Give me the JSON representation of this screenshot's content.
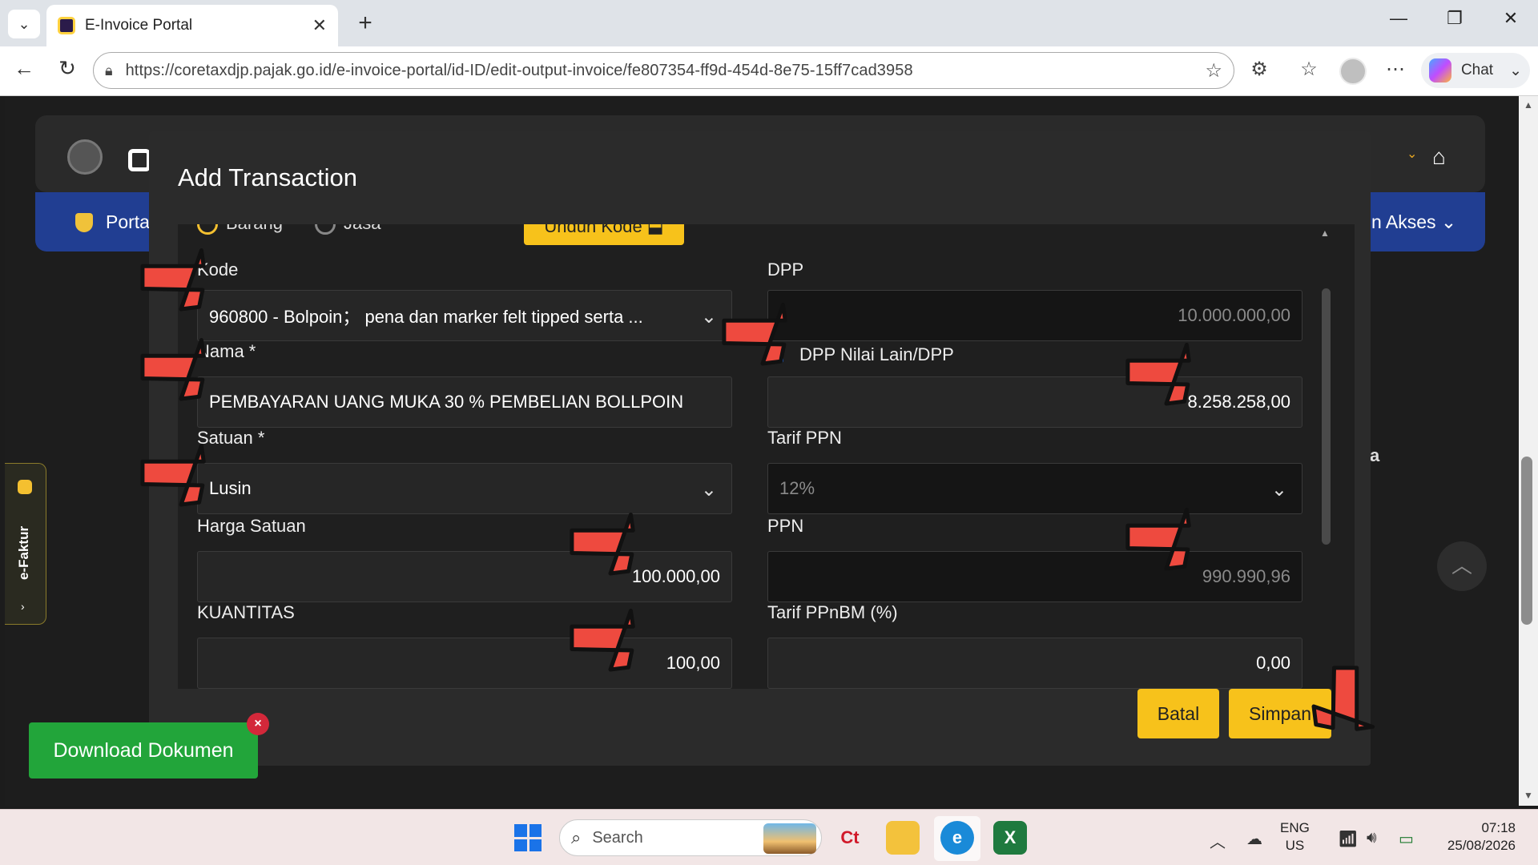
{
  "browser": {
    "tab_title": "E-Invoice Portal",
    "tab_close": "✕",
    "new_tab": "+",
    "url": "https://coretaxdjp.pajak.go.id/e-invoice-portal/id-ID/edit-output-invoice/fe807354-ff9d-454d-8e75-15ff7cad3958",
    "chat_label": "Chat",
    "window_controls": [
      "—",
      "❐",
      "✕"
    ]
  },
  "app": {
    "portal_label": "Portal",
    "akses_label": "n Akses ⌄",
    "side_label": "e-Faktur",
    "bg_letter": "a"
  },
  "modal": {
    "title": "Add Transaction",
    "radio_options": [
      "Barang",
      "Jasa"
    ],
    "unduh_label": "Unduh Kode ⬓",
    "kode_label": "Kode",
    "kode_value": "960800 - Bolpoin；  pena dan marker felt tipped serta ...",
    "nama_label": "Nama *",
    "nama_value": "PEMBAYARAN UANG MUKA 30 % PEMBELIAN BOLLPOIN",
    "satuan_label": "Satuan *",
    "satuan_value": "Lusin",
    "harga_label": "Harga Satuan",
    "harga_value": "100.000,00",
    "kuantitas_label": "KUANTITAS",
    "kuantitas_value": "100,00",
    "dpp_label": "DPP",
    "dpp_value": "10.000.000,00",
    "dpp_lain_label": "DPP Nilai Lain/DPP",
    "dpp_lain_checked": true,
    "dpp_lain_value": "8.258.258,00",
    "tarif_ppn_label": "Tarif PPN",
    "tarif_ppn_value": "12%",
    "ppn_label": "PPN",
    "ppn_value": "990.990,96",
    "tarif_ppnbm_label": "Tarif PPnBM (%)",
    "tarif_ppnbm_value": "0,00",
    "batal_label": "Batal",
    "simpan_label": "Simpan"
  },
  "download": {
    "label": "Download Dokumen",
    "close": "×"
  },
  "taskbar": {
    "search_placeholder": "Search",
    "lang_line1": "ENG",
    "lang_line2": "US",
    "time": "07:18",
    "date": "25/08/2026"
  },
  "colors": {
    "accent_yellow": "#f7c21b",
    "download_green": "#22a53a",
    "nav_blue": "#213e92",
    "annotation_red": "#ee4a3f"
  },
  "icons": [
    "search-icon",
    "home-icon",
    "chevron-down-icon",
    "star-icon",
    "lock-icon",
    "refresh-icon",
    "back-icon",
    "wifi-icon",
    "volume-icon",
    "battery-icon"
  ]
}
